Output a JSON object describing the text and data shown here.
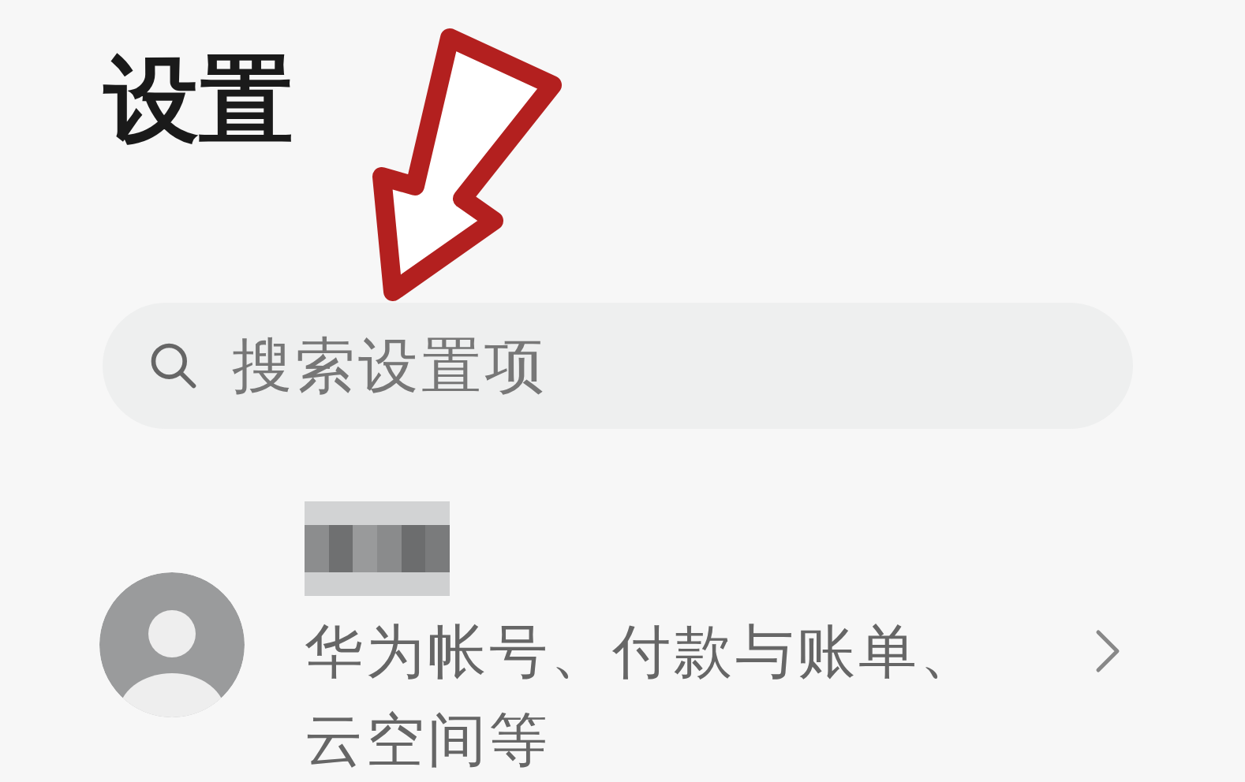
{
  "title": "设置",
  "search": {
    "placeholder": "搜索设置项"
  },
  "account": {
    "subtitle": "华为帐号、付款与账单、云空间等"
  }
}
